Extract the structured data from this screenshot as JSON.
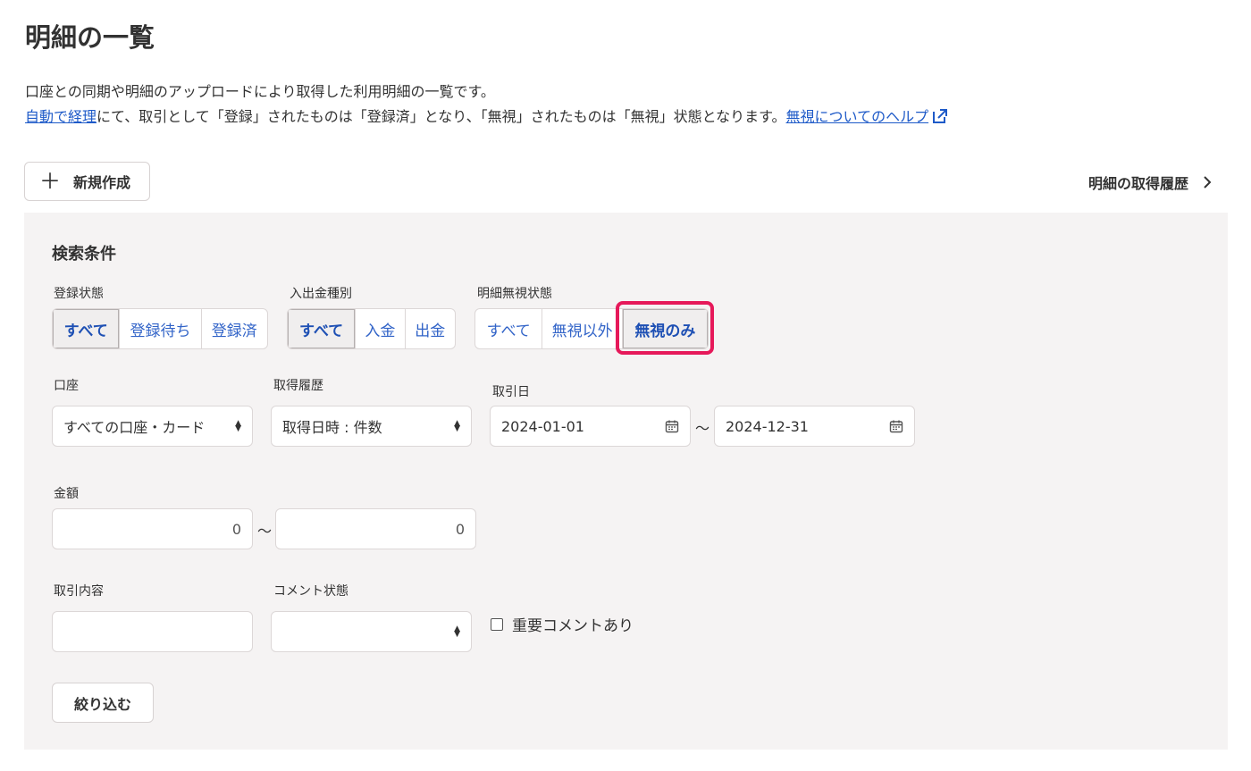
{
  "page": {
    "title": "明細の一覧",
    "description_line1": "口座との同期や明細のアップロードにより取得した利用明細の一覧です。",
    "description_link1": "自動で経理",
    "description_line2": "にて、取引として「登録」されたものは「登録済」となり、「無視」されたものは「無視」状態となります。",
    "help_link": "無視についてのヘルプ"
  },
  "toolbar": {
    "new_button": "新規作成",
    "history_link": "明細の取得履歴"
  },
  "search": {
    "title": "検索条件",
    "registration": {
      "label": "登録状態",
      "options": [
        "すべて",
        "登録待ち",
        "登録済"
      ],
      "selected": "すべて"
    },
    "flow": {
      "label": "入出金種別",
      "options": [
        "すべて",
        "入金",
        "出金"
      ],
      "selected": "すべて"
    },
    "ignore": {
      "label": "明細無視状態",
      "options": [
        "すべて",
        "無視以外",
        "無視のみ"
      ],
      "selected": "無視のみ"
    },
    "account": {
      "label": "口座",
      "value": "すべての口座・カード"
    },
    "fetch_history": {
      "label": "取得履歴",
      "value": "取得日時 : 件数"
    },
    "date": {
      "label": "取引日",
      "from": "2024-01-01",
      "to": "2024-12-31",
      "separator": "〜"
    },
    "amount": {
      "label": "金額",
      "from": "0",
      "to": "0",
      "separator": "〜"
    },
    "content": {
      "label": "取引内容",
      "value": ""
    },
    "comment": {
      "label": "コメント状態",
      "value": ""
    },
    "important_comment": {
      "label": "重要コメントあり",
      "checked": false
    },
    "filter_button": "絞り込む"
  },
  "colors": {
    "link": "#1e5ac8",
    "highlight": "#e6195a",
    "panel_bg": "#f5f3f3"
  },
  "icons": [
    "plus-icon",
    "chevron-right-icon",
    "external-link-icon",
    "calendar-icon",
    "select-arrows-icon",
    "checkbox-icon"
  ]
}
